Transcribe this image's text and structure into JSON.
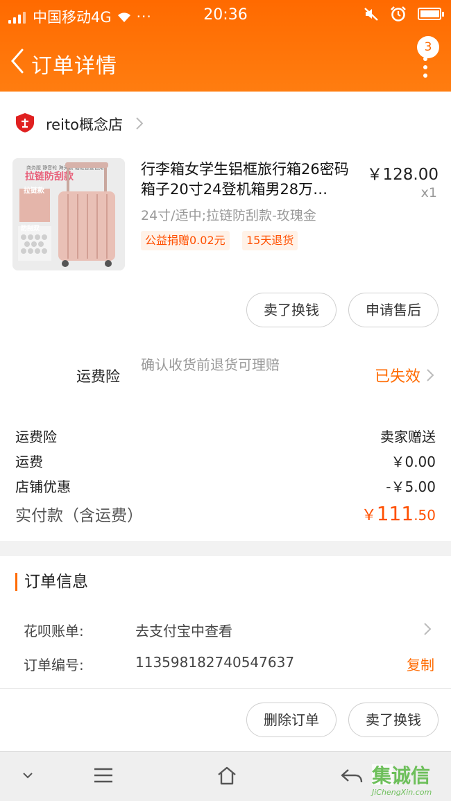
{
  "status_bar": {
    "carrier": "中国移动4G",
    "dots": "···",
    "time": "20:36"
  },
  "nav": {
    "title": "订单详情",
    "badge_count": "3"
  },
  "shop": {
    "name": "reito概念店"
  },
  "product": {
    "title": "行李箱女学生铝框旅行箱26密码箱子20寸24登机箱男28万…",
    "price": "￥128.00",
    "qty": "x1",
    "spec": "24寸/适中;拉链防刮款-玫瑰金",
    "tags": [
      "公益捐赠0.02元",
      "15天退货"
    ],
    "thumb_texts": [
      "商务版 静音轮 海关锁 铝框合金包角",
      "拉链防刮款",
      "拉链款",
      "防刮双"
    ]
  },
  "actions": {
    "sell_label": "卖了换钱",
    "after_sale_label": "申请售后"
  },
  "insurance": {
    "label": "运费险",
    "desc": "确认收货前退货可理赔",
    "status": "已失效"
  },
  "fees": [
    {
      "label": "运费险",
      "value": "卖家赠送"
    },
    {
      "label": "运费",
      "value": "￥0.00"
    },
    {
      "label": "店铺优惠",
      "value": "-￥5.00"
    }
  ],
  "total": {
    "label": "实付款（含运费）",
    "currency": "￥",
    "integer": "111",
    "decimal": ".50"
  },
  "order_info": {
    "title": "订单信息",
    "huabei_label": "花呗账单:",
    "huabei_value": "去支付宝中查看",
    "order_no_label": "订单编号:",
    "order_no_value": "113598182740547637",
    "copy_label": "复制"
  },
  "bottom_actions": {
    "delete_label": "删除订单",
    "sell_label": "卖了换钱"
  },
  "watermark": {
    "text": "集诚信",
    "sub": "JiChengXin.com"
  },
  "colors": {
    "accent": "#ff6a00",
    "price_red": "#ff5000"
  }
}
